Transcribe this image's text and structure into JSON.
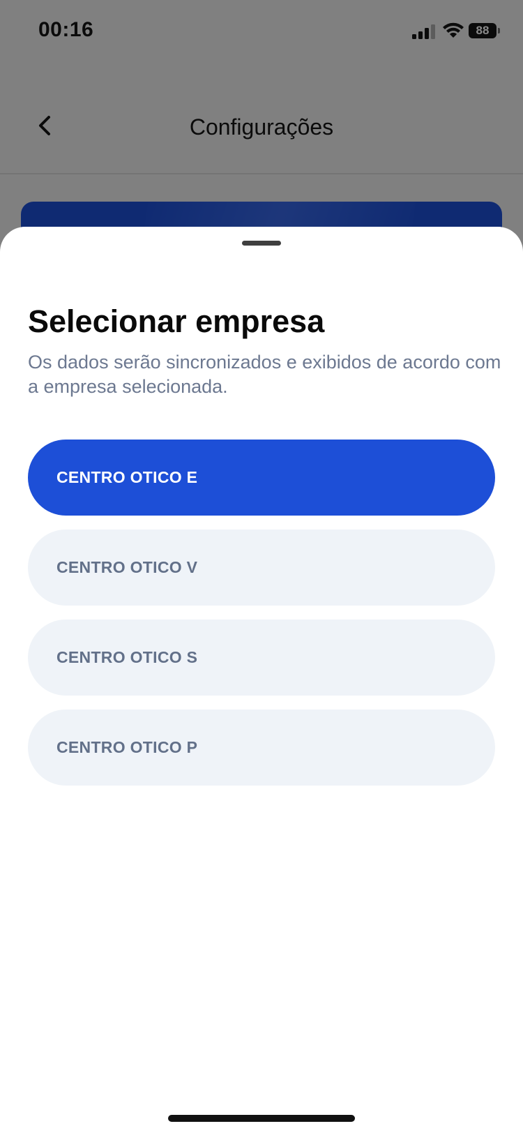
{
  "status_bar": {
    "time": "00:16",
    "battery_level": "88",
    "icons": [
      "signal-icon",
      "wifi-icon",
      "battery-icon"
    ]
  },
  "nav": {
    "title": "Configurações",
    "back_icon": "chevron-left-icon"
  },
  "sheet": {
    "title": "Selecionar empresa",
    "subtitle": "Os dados serão sincronizados e exibidos de acordo com a empresa selecionada.",
    "selected_index": 0,
    "options": [
      {
        "label": "CENTRO OTICO E"
      },
      {
        "label": "CENTRO OTICO V"
      },
      {
        "label": "CENTRO OTICO S"
      },
      {
        "label": "CENTRO OTICO P"
      }
    ]
  },
  "colors": {
    "accent": "#1d4fd7",
    "option_bg": "#eff3f8",
    "option_text": "#627089",
    "subtitle_text": "#6c7890",
    "backdrop": "#808080",
    "card_dark_blue": "#0f2a72"
  }
}
